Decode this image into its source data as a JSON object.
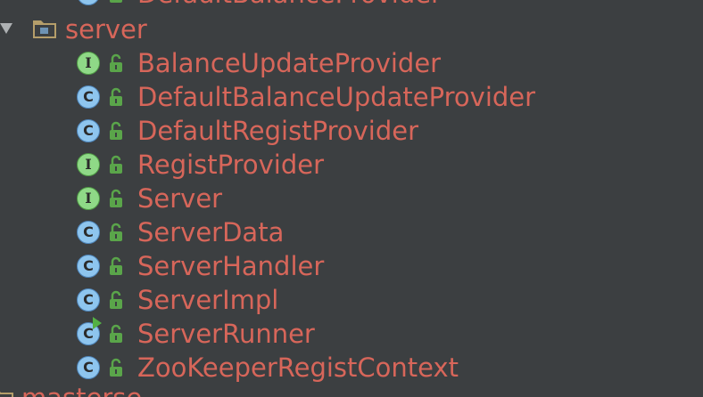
{
  "tree": {
    "top_partial_label": "DefaultBalanceProvider",
    "package": {
      "label": "server",
      "icon": "package-folder-icon"
    },
    "items": [
      {
        "label": "BalanceUpdateProvider",
        "kind": "interface",
        "badge": "I"
      },
      {
        "label": "DefaultBalanceUpdateProvider",
        "kind": "class",
        "badge": "C"
      },
      {
        "label": "DefaultRegistProvider",
        "kind": "class",
        "badge": "C"
      },
      {
        "label": "RegistProvider",
        "kind": "interface",
        "badge": "I"
      },
      {
        "label": "Server",
        "kind": "interface",
        "badge": "I"
      },
      {
        "label": "ServerData",
        "kind": "class",
        "badge": "C"
      },
      {
        "label": "ServerHandler",
        "kind": "class",
        "badge": "C"
      },
      {
        "label": "ServerImpl",
        "kind": "class",
        "badge": "C"
      },
      {
        "label": "ServerRunner",
        "kind": "runnable-class",
        "badge": "C"
      },
      {
        "label": "ZooKeeperRegistContext",
        "kind": "class",
        "badge": "C"
      }
    ],
    "bottom_partial_label": "masterse",
    "colors": {
      "background": "#3c3f41",
      "label": "#d7665a",
      "class_badge": "#8ec5ee",
      "interface_badge": "#8fd987",
      "lock": "#5aa54a"
    }
  }
}
